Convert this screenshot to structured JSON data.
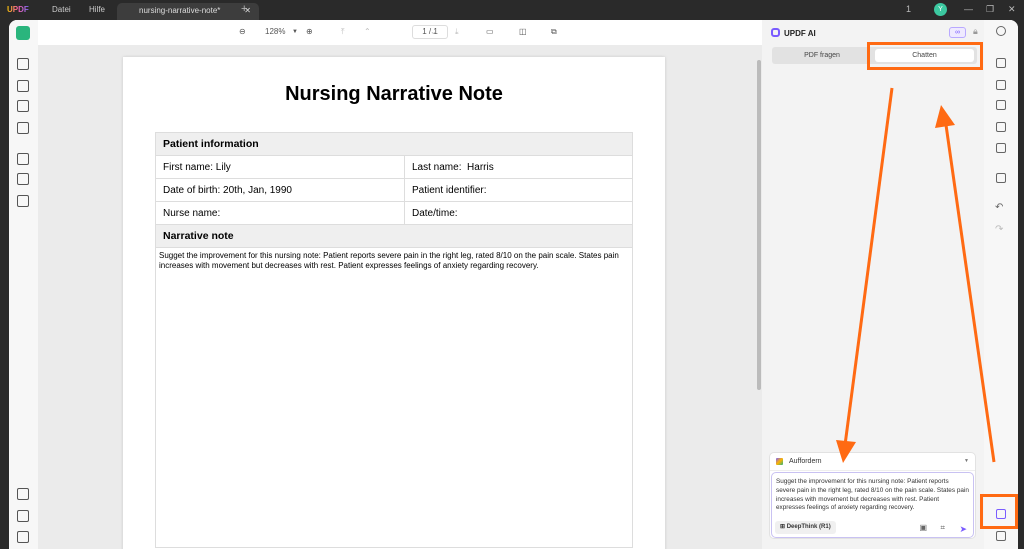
{
  "titlebar": {
    "logo": "UPDF",
    "menu": [
      "Datei",
      "Hilfe"
    ],
    "tab_title": "nursing-narrative-note*",
    "page_count_indicator": "1",
    "avatar_initial": "Y"
  },
  "toolbar": {
    "zoom": "128%",
    "page": "1 / 1"
  },
  "document": {
    "title": "Nursing Narrative Note",
    "section1": "Patient information",
    "first_name_label": "First name:",
    "first_name": "Lily",
    "last_name_label": "Last name:",
    "last_name": "Harris",
    "dob_label": "Date of birth:",
    "dob": "20th, Jan, 1990",
    "patient_id_label": "Patient identifier:",
    "nurse_label": "Nurse name:",
    "datetime_label": "Date/time:",
    "section2": "Narrative note",
    "note": "Sugget the improvement for this nursing note: Patient reports severe pain in the right leg, rated 8/10 on the pain scale. States pain increases with movement but decreases with rest. Patient expresses feelings of anxiety regarding recovery."
  },
  "ai_panel": {
    "title": "UPDF AI",
    "tabs": [
      "PDF fragen",
      "Chatten"
    ],
    "active_tab": "Chatten",
    "prompt_selector": "Auffordern",
    "input_text": "Sugget the improvement for this nursing note: Patient reports severe pain in the right leg, rated 8/10 on the pain scale. States pain increases with movement but decreases with rest. Patient expresses feelings of anxiety regarding recovery.",
    "deepthink_label": "DeepThink (R1)"
  },
  "colors": {
    "accent": "#7a5cff",
    "annotation": "#ff6a13",
    "brand_green": "#2ab57d"
  }
}
